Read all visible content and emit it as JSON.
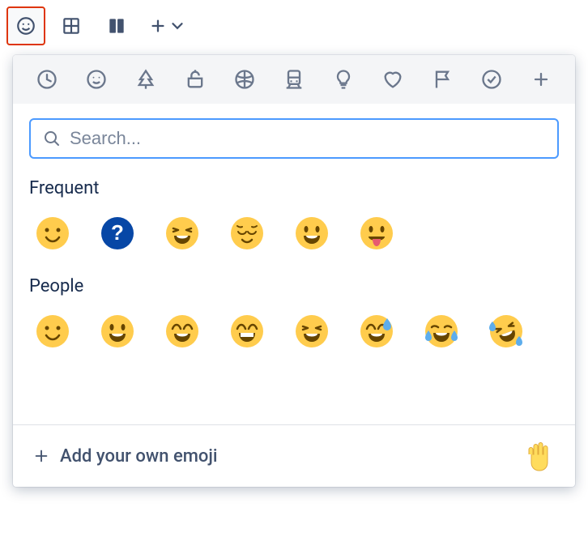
{
  "toolbar": {
    "items": [
      {
        "name": "emoji",
        "selected": true
      },
      {
        "name": "table",
        "selected": false
      },
      {
        "name": "layouts",
        "selected": false
      }
    ]
  },
  "picker": {
    "categories": [
      "frequent",
      "people",
      "nature",
      "food",
      "activity",
      "travel",
      "objects",
      "symbols",
      "flags",
      "productivity",
      "custom"
    ],
    "search": {
      "placeholder": "Search..."
    },
    "sections": {
      "frequent": {
        "heading": "Frequent",
        "emojis": [
          "slightly_smiling_face",
          "question_blue",
          "laughing_squint",
          "relieved",
          "smiley",
          "tongue_out"
        ]
      },
      "people": {
        "heading": "People",
        "emojis": [
          "slightly_smiling_face",
          "smiley",
          "smile_eyes",
          "grin",
          "laughing_squint",
          "sweat_smile",
          "joy",
          "rofl"
        ]
      }
    },
    "footer": {
      "add_label": "Add your own emoji",
      "skin_tone": "raised_hand"
    }
  }
}
